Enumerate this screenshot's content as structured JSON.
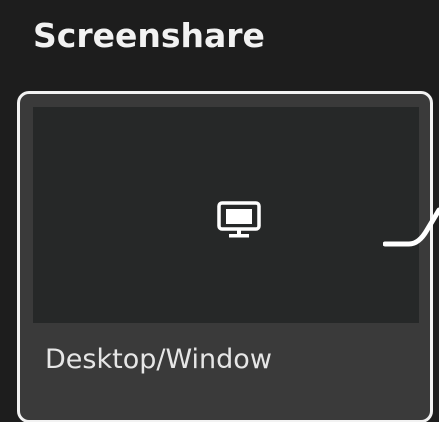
{
  "section": {
    "title": "Screenshare"
  },
  "source_card": {
    "label": "Desktop/Window",
    "icon": "monitor-icon",
    "selected": true
  },
  "colors": {
    "background": "#1d1d1d",
    "card_background": "#3a3a3a",
    "preview_background": "#262828",
    "selection_border": "#f2f2f2",
    "text": "#e6e6e6"
  }
}
